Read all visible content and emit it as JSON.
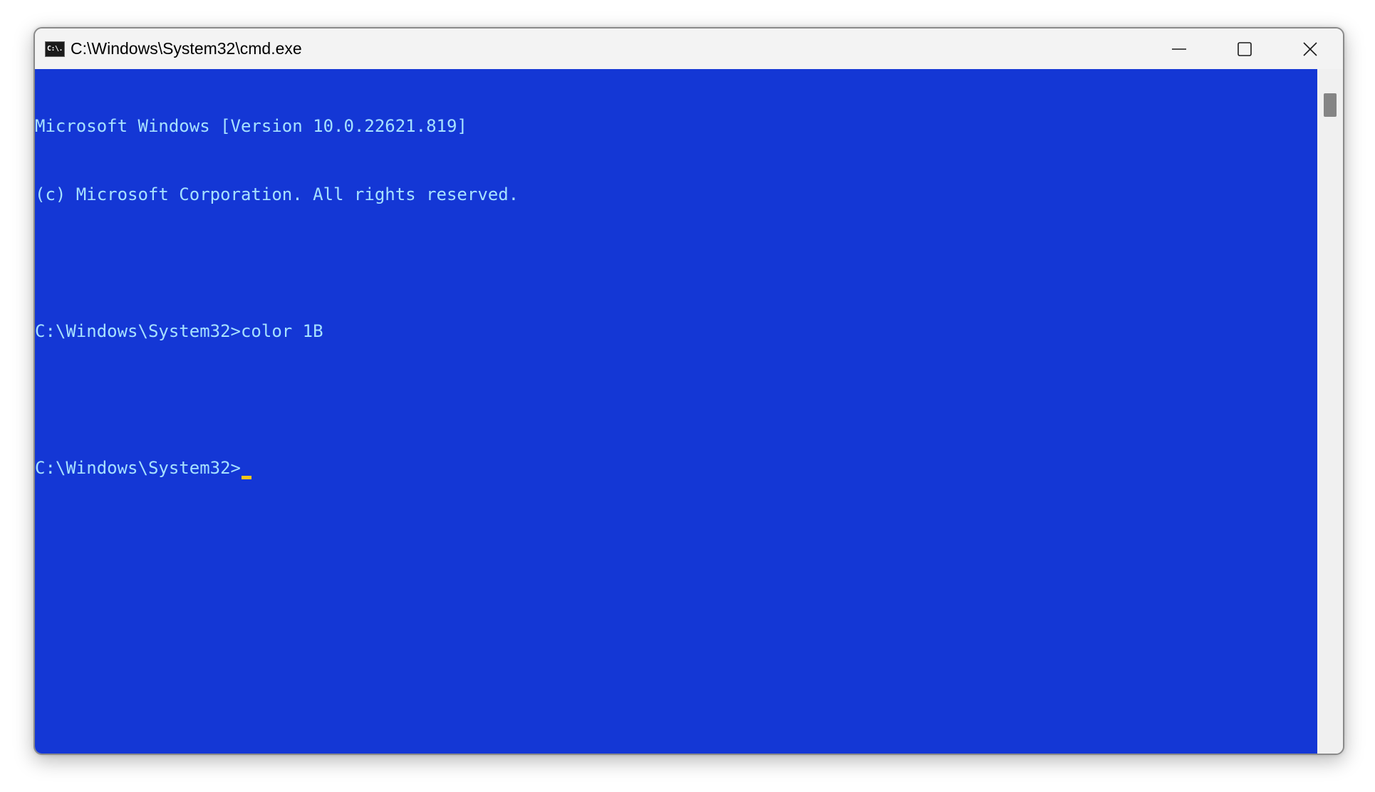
{
  "window": {
    "title": "C:\\Windows\\System32\\cmd.exe",
    "app_icon_glyph": "C:\\.",
    "app_icon": "cmd-icon"
  },
  "caption_buttons": {
    "minimize_icon": "minimize-icon",
    "maximize_icon": "maximize-icon",
    "close_icon": "close-icon"
  },
  "console": {
    "background_color": "#1437d5",
    "text_color": "#a7e1ff",
    "cursor_color": "#f5c518",
    "lines": [
      "Microsoft Windows [Version 10.0.22621.819]",
      "(c) Microsoft Corporation. All rights reserved.",
      "",
      "C:\\Windows\\System32>color 1B",
      "",
      "C:\\Windows\\System32>"
    ]
  }
}
